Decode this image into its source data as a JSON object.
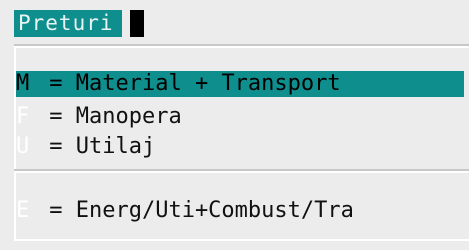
{
  "window": {
    "title": "Preturi"
  },
  "menu": {
    "items": [
      {
        "key": "M",
        "label": " = Material + Transport",
        "selected": true
      },
      {
        "key": "F",
        "label": " = Manopera",
        "selected": false
      },
      {
        "key": "U",
        "label": " = Utilaj",
        "selected": false
      },
      {
        "key": "E",
        "label": " = Energ/Uti+Combust/Tra",
        "selected": false
      }
    ]
  },
  "colors": {
    "accent": "#0f8e8e",
    "background": "#ececec",
    "hotkey_inactive": "#ffffff",
    "text": "#111111"
  }
}
